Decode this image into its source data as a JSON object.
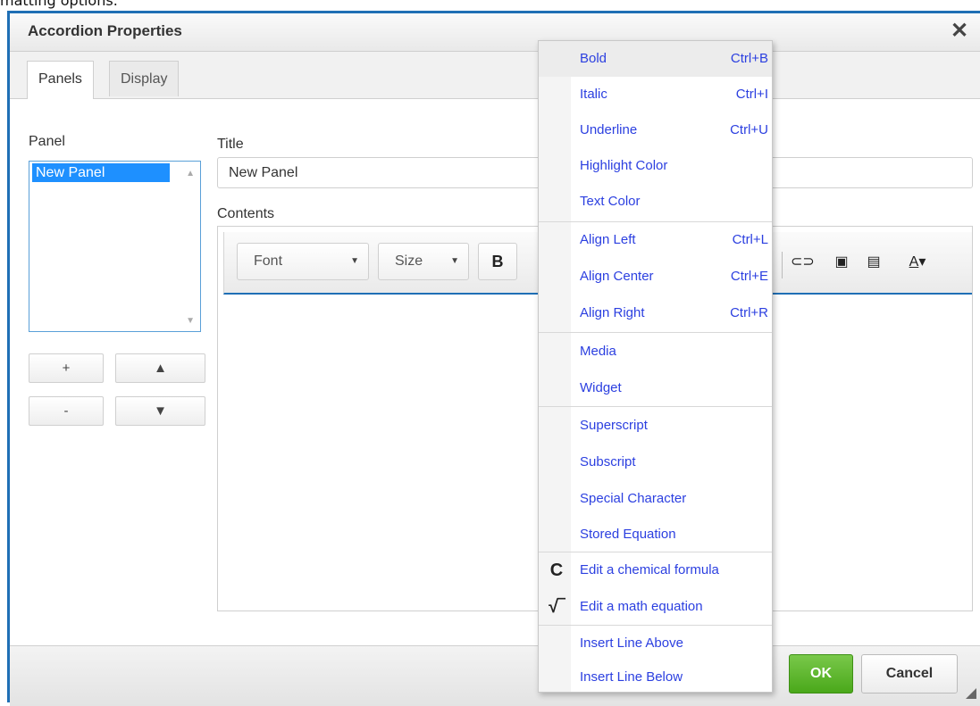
{
  "top_partial_text": "matting options.",
  "dialog": {
    "title": "Accordion Properties",
    "tabs": [
      "Panels",
      "Display"
    ],
    "panel_label": "Panel",
    "panel_items": [
      "New Panel"
    ],
    "title_label": "Title",
    "title_value": "New Panel",
    "contents_label": "Contents",
    "buttons": {
      "add": "+",
      "up": "▲",
      "remove": "-",
      "down": "▼"
    },
    "toolbar": {
      "font": "Font",
      "size": "Size",
      "bold": "B"
    },
    "ok": "OK",
    "cancel": "Cancel"
  },
  "context_menu": {
    "items": [
      {
        "label": "Bold",
        "shortcut": "Ctrl+B"
      },
      {
        "label": "Italic",
        "shortcut": "Ctrl+I"
      },
      {
        "label": "Underline",
        "shortcut": "Ctrl+U"
      },
      {
        "label": "Highlight Color",
        "shortcut": ""
      },
      {
        "label": "Text Color",
        "shortcut": ""
      },
      {
        "label": "Align Left",
        "shortcut": "Ctrl+L"
      },
      {
        "label": "Align Center",
        "shortcut": "Ctrl+E"
      },
      {
        "label": "Align Right",
        "shortcut": "Ctrl+R"
      },
      {
        "label": "Media",
        "shortcut": ""
      },
      {
        "label": "Widget",
        "shortcut": ""
      },
      {
        "label": "Superscript",
        "shortcut": ""
      },
      {
        "label": "Subscript",
        "shortcut": ""
      },
      {
        "label": "Special Character",
        "shortcut": ""
      },
      {
        "label": "Stored Equation",
        "shortcut": ""
      },
      {
        "label": "Edit a chemical formula",
        "shortcut": "",
        "icon": "C"
      },
      {
        "label": "Edit a math equation",
        "shortcut": "",
        "icon": "√‾"
      },
      {
        "label": "Insert Line Above",
        "shortcut": ""
      },
      {
        "label": "Insert Line Below",
        "shortcut": ""
      }
    ]
  },
  "colors": {
    "accent": "#1f6fb5",
    "ok": "#4aa81a",
    "menu_text": "#2b3fe0"
  }
}
